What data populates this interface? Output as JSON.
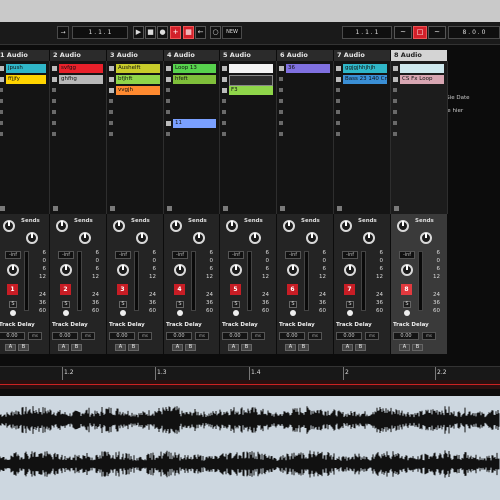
{
  "toolbar": {
    "position": "1 . 1 . 1",
    "new_label": "NEW",
    "loop_start": "1 . 1 . 1",
    "loop_length": "8 . 0 . 0"
  },
  "tracks": [
    {
      "name": "1 Audio",
      "number": "1",
      "clips": [
        {
          "name": "jpush",
          "color": "#2fb6c8"
        },
        {
          "name": "ffjjfy",
          "color": "#ffd400"
        }
      ]
    },
    {
      "name": "2 Audio",
      "number": "2",
      "clips": [
        {
          "name": "svfgg",
          "color": "#e8202a"
        },
        {
          "name": "ghfhg",
          "color": "#b8b8b8"
        }
      ]
    },
    {
      "name": "3 Audio",
      "number": "3",
      "clips": [
        {
          "name": "Aushelft",
          "color": "#c8cc2a"
        },
        {
          "name": "bfjhft",
          "color": "#8fd64a"
        },
        {
          "name": "vvgjh",
          "color": "#ff8a30"
        }
      ]
    },
    {
      "name": "4 Audio",
      "number": "4",
      "clips": [
        {
          "name": "Loop 13",
          "color": "#57d24d"
        },
        {
          "name": "hfeft",
          "color": "#7fbf3a"
        },
        {
          "name": "",
          "color": ""
        },
        {
          "name": "",
          "color": ""
        },
        {
          "name": "",
          "color": ""
        },
        {
          "name": "11",
          "color": "#7aa0ff"
        }
      ]
    },
    {
      "name": "5 Audio",
      "number": "5",
      "clips": [
        {
          "name": "",
          "color": "#f2f2f2"
        },
        {
          "name": "",
          "color": "#2b2b2b"
        },
        {
          "name": "F3",
          "color": "#8fd64a"
        }
      ]
    },
    {
      "name": "6 Audio",
      "number": "6",
      "clips": [
        {
          "name": "36",
          "color": "#7f70e0"
        }
      ]
    },
    {
      "name": "7 Audio",
      "number": "7",
      "clips": [
        {
          "name": "ggjgjhhjhjh",
          "color": "#2fb6c8"
        },
        {
          "name": "Bass 23 140 Cm",
          "color": "#3a8fd6"
        }
      ]
    },
    {
      "name": "8 Audio",
      "number": "8",
      "clips": [
        {
          "name": "",
          "color": "#cfe9ee"
        },
        {
          "name": "CS Fx Loop",
          "color": "#d8a6b2"
        }
      ]
    }
  ],
  "drop_zone": {
    "line1": "Ziehen Sie Date",
    "line2": "Geräte hier"
  },
  "mixer": {
    "sends_label": "Sends",
    "knob_a": "A",
    "knob_b": "B",
    "db_value": "-inf",
    "scale": [
      "6",
      "0",
      "6",
      "12",
      "24",
      "36",
      "60"
    ],
    "track_delay_label": "Track Delay",
    "track_delay_value": "0.00",
    "track_delay_unit": "ms",
    "solo_label": "S",
    "ab_a": "A",
    "ab_b": "B"
  },
  "ruler": {
    "marks": [
      "1.2",
      "1.3",
      "1.4",
      "2",
      "2.2"
    ]
  },
  "colors": {
    "record_red": "#c81d25",
    "accent_red": "#d2202a",
    "waveform": "#111111",
    "waveform_bg": "#cdd7e0"
  }
}
